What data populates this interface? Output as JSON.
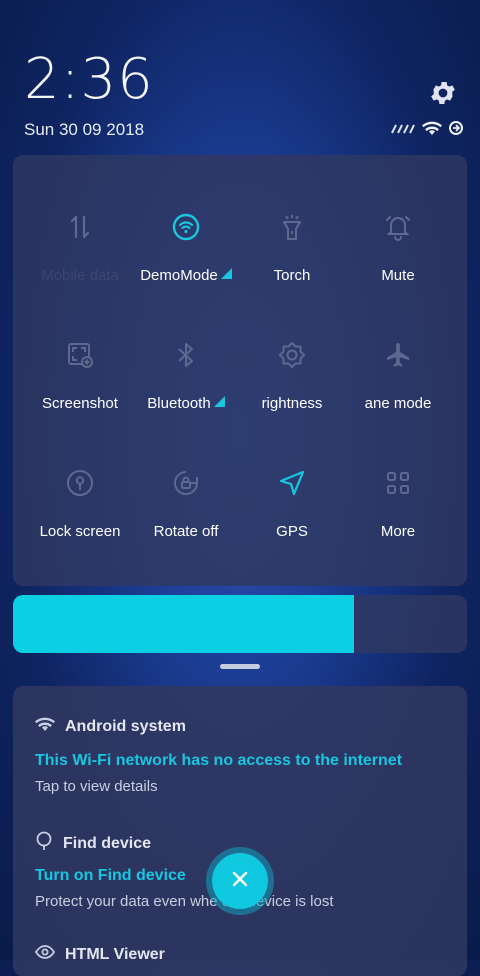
{
  "header": {
    "time": "2:36",
    "date": "Sun 30 09 2018"
  },
  "quick_settings": {
    "tiles": [
      {
        "label": "Mobile data",
        "icon": "mobile-data-icon",
        "active": false,
        "dim": true
      },
      {
        "label": "DemoMode",
        "icon": "wifi-icon",
        "active": true,
        "expandable": true
      },
      {
        "label": "Torch",
        "icon": "torch-icon",
        "active": false
      },
      {
        "label": "Mute",
        "icon": "bell-icon",
        "active": false
      },
      {
        "label": "Screenshot",
        "icon": "screenshot-icon",
        "active": false
      },
      {
        "label": "Bluetooth",
        "icon": "bluetooth-icon",
        "active": false,
        "expandable": true
      },
      {
        "label": "rightness",
        "icon": "brightness-icon",
        "active": false
      },
      {
        "label": "ane mode",
        "icon": "airplane-icon",
        "active": false
      },
      {
        "label": "Lock screen",
        "icon": "lock-screen-icon",
        "active": false
      },
      {
        "label": "Rotate off",
        "icon": "rotate-lock-icon",
        "active": false
      },
      {
        "label": "GPS",
        "icon": "gps-icon",
        "active": true
      },
      {
        "label": "More",
        "icon": "grid-icon",
        "active": false
      }
    ],
    "brightness_level": 0.75
  },
  "notifications": [
    {
      "app": "Android system",
      "icon": "wifi-warning-icon",
      "title": "This Wi-Fi network has no access to the internet",
      "body": "Tap to view details"
    },
    {
      "app": "Find device",
      "icon": "location-pin-icon",
      "title": "Turn on Find device",
      "body": "Protect your data even whe    our device is lost"
    },
    {
      "app": "HTML Viewer",
      "icon": "eye-icon"
    }
  ],
  "colors": {
    "accent": "#19c6e0",
    "panel": "#303860",
    "icon_inactive": "#5f6890"
  }
}
